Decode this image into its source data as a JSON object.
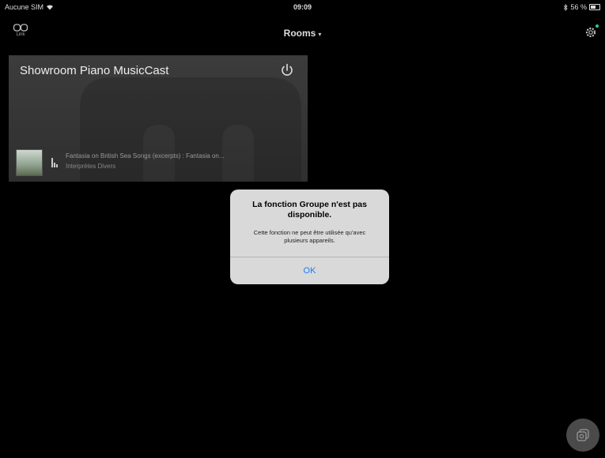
{
  "status_bar": {
    "carrier": "Aucune SIM",
    "time": "09:09",
    "battery": "56 %"
  },
  "nav": {
    "link_label": "Link",
    "title": "Rooms",
    "title_caret": "▾"
  },
  "room": {
    "name": "Showroom Piano MusicCast",
    "track_title": "Fantasia on British Sea Songs (excerpts) : Fantasia on...",
    "track_artist": "Interprètes Divers"
  },
  "alert": {
    "title": "La fonction Groupe n'est pas disponible.",
    "message": "Cette fonction ne peut être utilisée qu'avec plusieurs appareils.",
    "ok_label": "OK"
  },
  "icons": {
    "link": "link-icon",
    "settings": "gear-icon",
    "power": "power-icon",
    "equalizer": "equalizer-icon",
    "fab": "group-icon",
    "wifi": "wifi-icon",
    "bluetooth": "bluetooth-icon",
    "battery": "battery-icon"
  },
  "colors": {
    "background": "#000000",
    "card": "#363636",
    "alert_bg": "#d9d9d9",
    "ok_blue": "#1a7cf7",
    "notification": "#2ad08a"
  }
}
